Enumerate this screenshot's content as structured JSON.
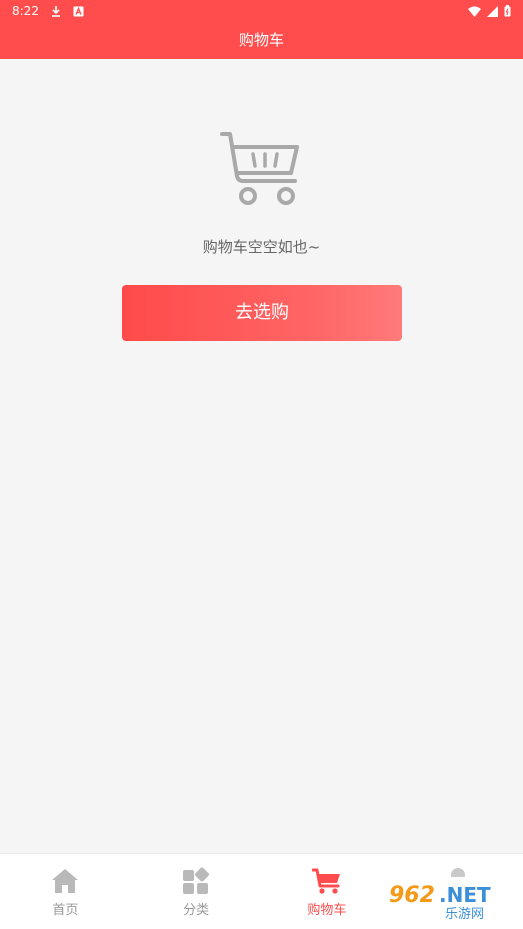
{
  "status_bar": {
    "time": "8:22",
    "icons": [
      "download-icon",
      "a-icon",
      "wifi-icon",
      "signal-icon",
      "battery-icon"
    ]
  },
  "header": {
    "title": "购物车"
  },
  "empty_state": {
    "message": "购物车空空如也~",
    "button_label": "去选购",
    "illustration": "cart-icon"
  },
  "tabbar": {
    "items": [
      {
        "label": "首页",
        "icon": "home-icon",
        "active": false
      },
      {
        "label": "分类",
        "icon": "grid-icon",
        "active": false
      },
      {
        "label": "购物车",
        "icon": "cart-icon",
        "active": true
      },
      {
        "label": "",
        "icon": "user-icon",
        "active": false
      }
    ]
  },
  "colors": {
    "accent": "#ff4d4d",
    "inactive_tab": "#999999",
    "background": "#f5f5f5"
  },
  "watermark": {
    "brand": "962.NET",
    "subtitle": "乐游网"
  }
}
